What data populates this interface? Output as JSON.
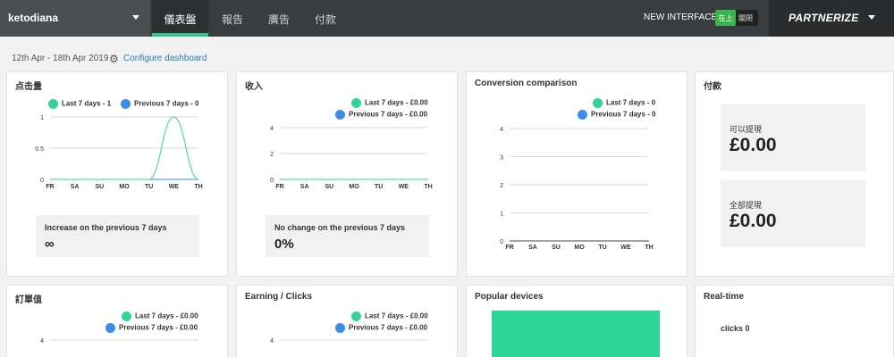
{
  "topbar": {
    "account": "ketodiana",
    "tabs": [
      {
        "label": "儀表盤",
        "active": true
      },
      {
        "label": "報告",
        "active": false
      },
      {
        "label": "廣告",
        "active": false
      },
      {
        "label": "付款",
        "active": false
      }
    ],
    "new_interface_label": "NEW INTERFACE",
    "toggle_on": "在上",
    "toggle_off": "關閉",
    "brand": "PARTNERIZE"
  },
  "daterange": "12th Apr - 18th Apr 2019",
  "configure_link": "Configure dashboard",
  "colors": {
    "current": "#2fd597",
    "previous": "#3b8de9"
  },
  "cards": {
    "clicks": {
      "title": "点击量",
      "legend_current": "Last 7 days - 1",
      "legend_previous": "Previous 7 days - 0",
      "stat_label": "Increase on the previous 7 days",
      "stat_value": "∞"
    },
    "income": {
      "title": "收入",
      "legend_current": "Last 7 days - £0.00",
      "legend_previous": "Previous 7 days - £0.00",
      "stat_label": "No change on the previous 7 days",
      "stat_value": "0%"
    },
    "conversion": {
      "title": "Conversion comparison",
      "legend_current": "Last 7 days - 0",
      "legend_previous": "Previous 7 days - 0"
    },
    "payment": {
      "title": "付款",
      "withdrawable_label": "可以提現",
      "withdrawable_value": "£0.00",
      "all_label": "全部提現",
      "all_value": "£0.00"
    },
    "order_value": {
      "title": "訂單值",
      "legend_current": "Last 7 days - £0.00",
      "legend_previous": "Previous 7 days - £0.00"
    },
    "earning_clicks": {
      "title": "Earning / Clicks",
      "legend_current": "Last 7 days - £0.00",
      "legend_previous": "Previous 7 days - £0.00"
    },
    "popular_devices": {
      "title": "Popular devices"
    },
    "realtime": {
      "title": "Real-time",
      "clicks_text": "clicks 0"
    }
  },
  "chart_data": [
    {
      "id": "clicks",
      "type": "line",
      "x": [
        "FR",
        "SA",
        "SU",
        "MO",
        "TU",
        "WE",
        "TH"
      ],
      "yticks": [
        "0",
        "0.5",
        "1"
      ],
      "ylim": [
        0,
        1
      ],
      "series": [
        {
          "name": "Last 7 days - 1",
          "values": [
            0,
            0,
            0,
            0,
            0,
            1,
            0
          ]
        },
        {
          "name": "Previous 7 days - 0",
          "values": [
            0,
            0,
            0,
            0,
            0,
            0,
            0
          ]
        }
      ]
    },
    {
      "id": "income",
      "type": "line",
      "x": [
        "FR",
        "SA",
        "SU",
        "MO",
        "TU",
        "WE",
        "TH"
      ],
      "yticks": [
        "0",
        "2",
        "4"
      ],
      "ylim": [
        0,
        4
      ],
      "series": [
        {
          "name": "Last 7 days - £0.00",
          "values": [
            0,
            0,
            0,
            0,
            0,
            0,
            0
          ]
        },
        {
          "name": "Previous 7 days - £0.00",
          "values": [
            0,
            0,
            0,
            0,
            0,
            0,
            0
          ]
        }
      ]
    },
    {
      "id": "conversion",
      "type": "bar",
      "x": [
        "FR",
        "SA",
        "SU",
        "MO",
        "TU",
        "WE",
        "TH"
      ],
      "yticks": [
        "0",
        "1",
        "2",
        "3",
        "4"
      ],
      "ylim": [
        0,
        4
      ],
      "series": [
        {
          "name": "Last 7 days - 0",
          "values": [
            0,
            0,
            0,
            0,
            0,
            0,
            0
          ]
        },
        {
          "name": "Previous 7 days - 0",
          "values": [
            0,
            0,
            0,
            0,
            0,
            0,
            0
          ]
        }
      ]
    },
    {
      "id": "order_value",
      "type": "line",
      "yticks": [
        "4"
      ],
      "ylim": [
        0,
        4
      ]
    },
    {
      "id": "earning_clicks",
      "type": "line",
      "yticks": [
        "4"
      ],
      "ylim": [
        0,
        4
      ]
    }
  ]
}
